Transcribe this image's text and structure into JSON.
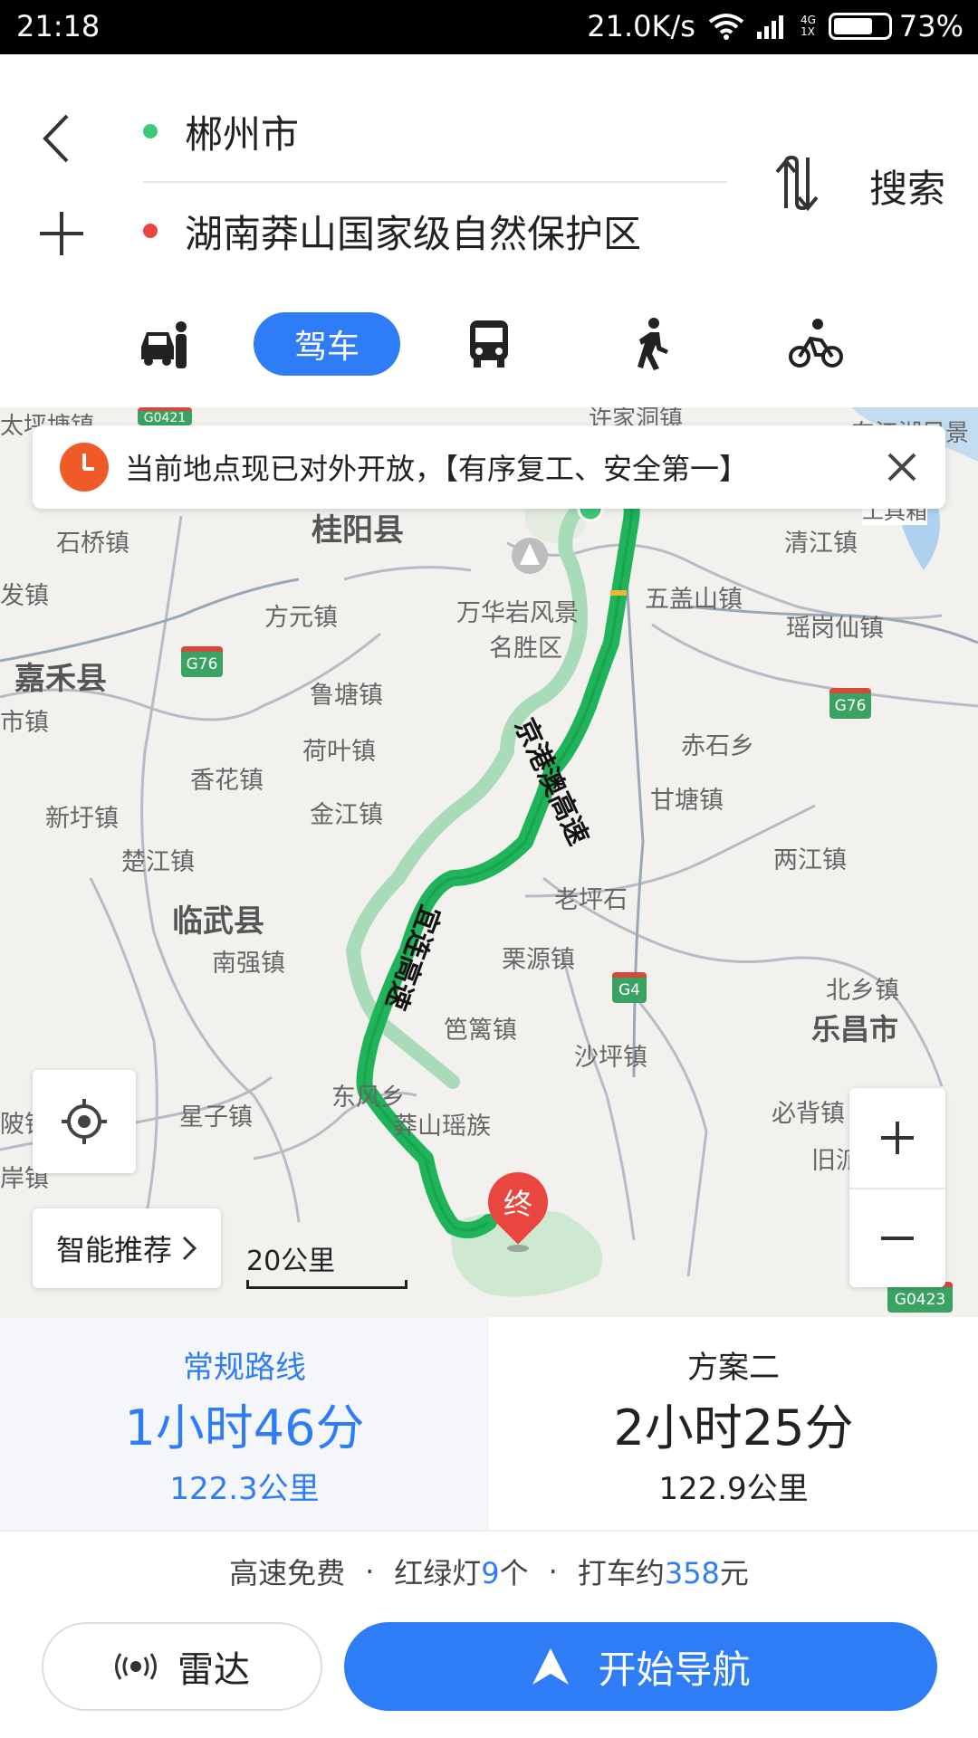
{
  "status_bar": {
    "time": "21:18",
    "speed": "21.0K/s",
    "network": "4G",
    "network_sub": "1X",
    "battery": "73%",
    "battery_level": 0.73
  },
  "header": {
    "origin": "郴州市",
    "destination": "湖南莽山国家级自然保护区",
    "search_label": "搜索",
    "origin_dot_color": "#3cc97a",
    "dest_dot_color": "#e8463f"
  },
  "modes": {
    "active": "驾车",
    "items": [
      "taxi-icon",
      "驾车",
      "bus-icon",
      "walk-icon",
      "bike-icon"
    ]
  },
  "notice": {
    "text": "当前地点现已对外开放，【有序复工、安全第一】"
  },
  "map": {
    "places": [
      {
        "id": "guiyang",
        "text": "桂阳县"
      },
      {
        "id": "jiahe",
        "text": "嘉禾县"
      },
      {
        "id": "linwu",
        "text": "临武县"
      },
      {
        "id": "lechang",
        "text": "乐昌市"
      },
      {
        "id": "shiqiao",
        "text": "石桥镇"
      },
      {
        "id": "fangyuan",
        "text": "方元镇"
      },
      {
        "id": "wanhuayan",
        "text": "万华岩风景"
      },
      {
        "id": "mingshengqu",
        "text": "名胜区"
      },
      {
        "id": "wugaishan",
        "text": "五盖山镇"
      },
      {
        "id": "qingjiang",
        "text": "清江镇"
      },
      {
        "id": "yaogangxian",
        "text": "瑶岗仙镇"
      },
      {
        "id": "lutang",
        "text": "鲁塘镇"
      },
      {
        "id": "heye",
        "text": "荷叶镇"
      },
      {
        "id": "xianghua",
        "text": "香花镇"
      },
      {
        "id": "jinjiang",
        "text": "金江镇"
      },
      {
        "id": "xinyu",
        "text": "新圩镇"
      },
      {
        "id": "chujiang",
        "text": "楚江镇"
      },
      {
        "id": "chishi",
        "text": "赤石乡"
      },
      {
        "id": "gantang",
        "text": "甘塘镇"
      },
      {
        "id": "liangjiang",
        "text": "两江镇"
      },
      {
        "id": "laopingshi",
        "text": "老坪石"
      },
      {
        "id": "nanqiang",
        "text": "南强镇"
      },
      {
        "id": "liyuan",
        "text": "栗源镇"
      },
      {
        "id": "beixiang",
        "text": "北乡镇"
      },
      {
        "id": "bali",
        "text": "笆篱镇"
      },
      {
        "id": "shaping",
        "text": "沙坪镇"
      },
      {
        "id": "dongfeng",
        "text": "东风乡"
      },
      {
        "id": "xingzi",
        "text": "星子镇"
      },
      {
        "id": "mangshanyao",
        "text": "莽山瑶族"
      },
      {
        "id": "bibei",
        "text": "必背镇"
      },
      {
        "id": "jiu",
        "text": "旧派"
      },
      {
        "id": "fa",
        "text": "发镇"
      },
      {
        "id": "shi",
        "text": "市镇"
      },
      {
        "id": "xujia",
        "text": "许家洞镇"
      },
      {
        "id": "dongjiang",
        "text": "东江湖风景"
      },
      {
        "id": "taiping",
        "text": "太坪塘镇"
      },
      {
        "id": "ling",
        "text": "陂镇"
      },
      {
        "id": "an",
        "text": "岸镇"
      },
      {
        "id": "gongju",
        "text": "工具箱"
      }
    ],
    "shields": [
      {
        "id": "g76a",
        "text": "G76"
      },
      {
        "id": "g76b",
        "text": "G76"
      },
      {
        "id": "g4",
        "text": "G4"
      },
      {
        "id": "g0423",
        "text": "G0423"
      },
      {
        "id": "g0421",
        "text": "G0421"
      }
    ],
    "road_names": [
      "京港澳高速",
      "宜连高速"
    ],
    "end_marker": "终",
    "recommend_label": "智能推荐",
    "scale": "20公里",
    "route_color": "#1fb35a",
    "alt_route_color": "#a8dbb8"
  },
  "plans": [
    {
      "name": "常规路线",
      "time": "1小时46分",
      "distance": "122.3公里"
    },
    {
      "name": "方案二",
      "time": "2小时25分",
      "distance": "122.9公里"
    }
  ],
  "info": {
    "toll": "高速免费",
    "lights_prefix": "红绿灯",
    "lights_count": "9",
    "lights_suffix": "个",
    "taxi_prefix": "打车约",
    "taxi_price": "358",
    "taxi_suffix": "元",
    "separator": "·"
  },
  "actions": {
    "radar": "雷达",
    "navigate": "开始导航"
  },
  "colors": {
    "accent": "#2f7df6",
    "notice_icon": "#f05a28",
    "end_marker": "#e8463f"
  }
}
